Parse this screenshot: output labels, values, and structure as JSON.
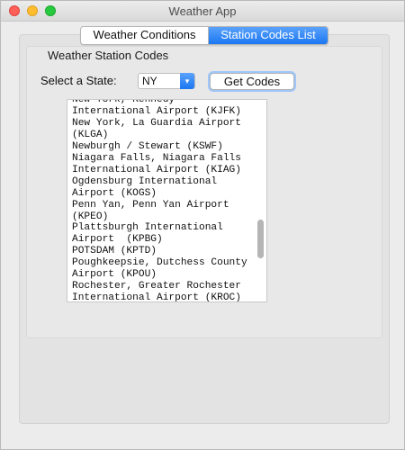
{
  "window": {
    "title": "Weather App"
  },
  "tabs": [
    {
      "label": "Weather Conditions",
      "selected": false
    },
    {
      "label": "Station Codes List",
      "selected": true
    }
  ],
  "group": {
    "title": "Weather Station Codes"
  },
  "state_select": {
    "label": "Select a State:",
    "value": "NY"
  },
  "get_codes_button": {
    "label": "Get Codes"
  },
  "station_list": {
    "lines": [
      "New York, Kennedy",
      "International Airport (KJFK)",
      "New York, La Guardia Airport",
      "(KLGA)",
      "Newburgh / Stewart (KSWF)",
      "Niagara Falls, Niagara Falls",
      "International Airport (KIAG)",
      "Ogdensburg International",
      "Airport (KOGS)",
      "Penn Yan, Penn Yan Airport",
      "(KPEO)",
      "Plattsburgh International",
      "Airport  (KPBG)",
      "POTSDAM (KPTD)",
      "Poughkeepsie, Dutchess County",
      "Airport (KPOU)",
      "Rochester, Greater Rochester",
      "International Airport (KROC)"
    ]
  },
  "colors": {
    "accent": "#1b77f2",
    "window_bg": "#ececec"
  },
  "icons": {
    "select_arrow": "chevron-up-down-icon"
  }
}
